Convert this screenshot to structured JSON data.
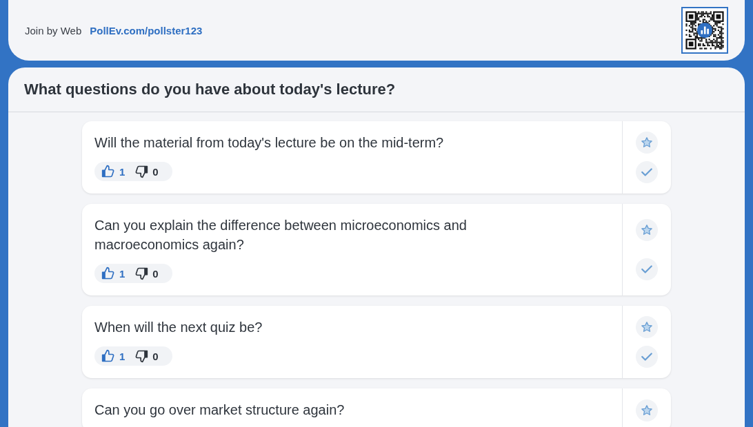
{
  "header": {
    "join_label": "Join by Web",
    "join_link": "PollEv.com/pollster123"
  },
  "poll": {
    "title": "What questions do you have about today's lecture?",
    "questions": [
      {
        "text": "Will the material from today's lecture be on the mid-term?",
        "upvotes": "1",
        "downvotes": "0",
        "upvoted": true
      },
      {
        "text": "Can you explain the difference between microeconomics and macroeconomics again?",
        "upvotes": "1",
        "downvotes": "0",
        "upvoted": true
      },
      {
        "text": "When will the next quiz be?",
        "upvotes": "1",
        "downvotes": "0",
        "upvoted": true
      },
      {
        "text": "Can you go over market structure again?"
      }
    ]
  }
}
